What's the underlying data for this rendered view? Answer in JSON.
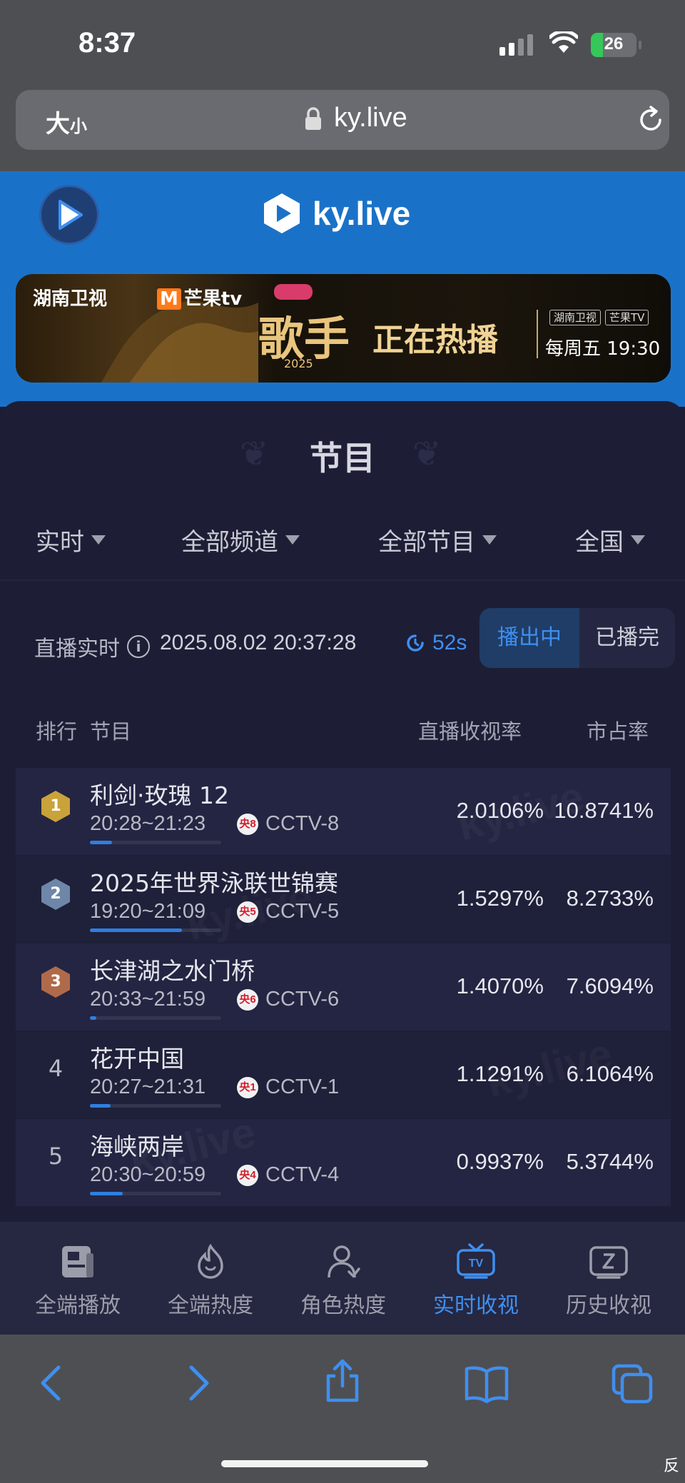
{
  "status_bar": {
    "time": "8:37",
    "battery": "26",
    "battery_level": 0.26
  },
  "browser": {
    "text_size": "大",
    "text_size_small": "小",
    "url": "ky.live"
  },
  "site": {
    "brand": "ky.live"
  },
  "banner": {
    "hunan_tv": "湖南卫视",
    "mango_tv": "芒果tv",
    "mango_mark": "M",
    "show_title": "歌手",
    "show_year": "2025",
    "on_air": "正在热播",
    "tag_hunan": "湖南卫视",
    "tag_mango": "芒果TV",
    "schedule": "每周五 19:30"
  },
  "panel": {
    "title": "节目",
    "filters": [
      "实时",
      "全部频道",
      "全部节目",
      "全国"
    ],
    "live_label": "直播实时",
    "live_time": "2025.08.02 20:37:28",
    "countdown": "52s",
    "segment": {
      "active": "播出中",
      "inactive": "已播完"
    },
    "headers": {
      "rank": "排行",
      "program": "节目",
      "rating": "直播收视率",
      "share": "市占率"
    },
    "watermark": "ky.live"
  },
  "rows": [
    {
      "rank": "1",
      "name": "利剑·玫瑰 12",
      "time": "20:28~21:23",
      "channel_icon": "央8",
      "channel": "CCTV-8",
      "rating": "2.0106%",
      "share": "10.8741%",
      "progress": 0.17,
      "medal_color": "#c9a23a"
    },
    {
      "rank": "2",
      "name": "2025年世界泳联世锦赛",
      "time": "19:20~21:09",
      "channel_icon": "央5",
      "channel": "CCTV-5",
      "rating": "1.5297%",
      "share": "8.2733%",
      "progress": 0.7,
      "medal_color": "#6e87a8"
    },
    {
      "rank": "3",
      "name": "长津湖之水门桥",
      "time": "20:33~21:59",
      "channel_icon": "央6",
      "channel": "CCTV-6",
      "rating": "1.4070%",
      "share": "7.6094%",
      "progress": 0.05,
      "medal_color": "#b06a4a"
    },
    {
      "rank": "4",
      "name": "花开中国",
      "time": "20:27~21:31",
      "channel_icon": "央1",
      "channel": "CCTV-1",
      "rating": "1.1291%",
      "share": "6.1064%",
      "progress": 0.16,
      "medal_color": ""
    },
    {
      "rank": "5",
      "name": "海峡两岸",
      "time": "20:30~20:59",
      "channel_icon": "央4",
      "channel": "CCTV-4",
      "rating": "0.9937%",
      "share": "5.3744%",
      "progress": 0.25,
      "medal_color": ""
    }
  ],
  "bottom_nav": [
    {
      "label": "全端播放",
      "icon": "play-board-icon"
    },
    {
      "label": "全端热度",
      "icon": "flame-icon"
    },
    {
      "label": "角色热度",
      "icon": "person-icon"
    },
    {
      "label": "实时收视",
      "icon": "tv-icon",
      "active": true
    },
    {
      "label": "历史收视",
      "icon": "history-tv-icon"
    }
  ],
  "colors": {
    "accent": "#3f8ff0",
    "header_blue": "#1a72c8",
    "panel_bg": "#1d1e36"
  },
  "corner_text": "反"
}
